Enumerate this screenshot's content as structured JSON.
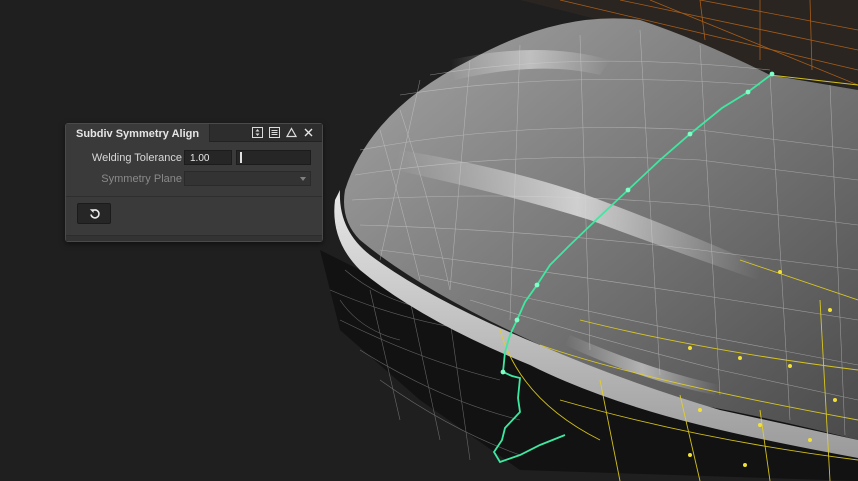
{
  "panel": {
    "title": "Subdiv Symmetry Align",
    "header_icons": [
      "collapse-expand-icon",
      "menu-icon",
      "triangle-icon",
      "close-icon"
    ],
    "welding_tolerance": {
      "label": "Welding Tolerance",
      "value": "1.00"
    },
    "symmetry_plane": {
      "label": "Symmetry Plane",
      "value": "",
      "enabled": false
    },
    "reset_icon": "reset-icon"
  },
  "viewport": {
    "background": "#1f1f1f",
    "wire_white": "#bfbfbf",
    "wire_yellow": "#e6d21e",
    "wire_orange": "#d07a22",
    "symmetry_seam": "#3ee8a0"
  }
}
